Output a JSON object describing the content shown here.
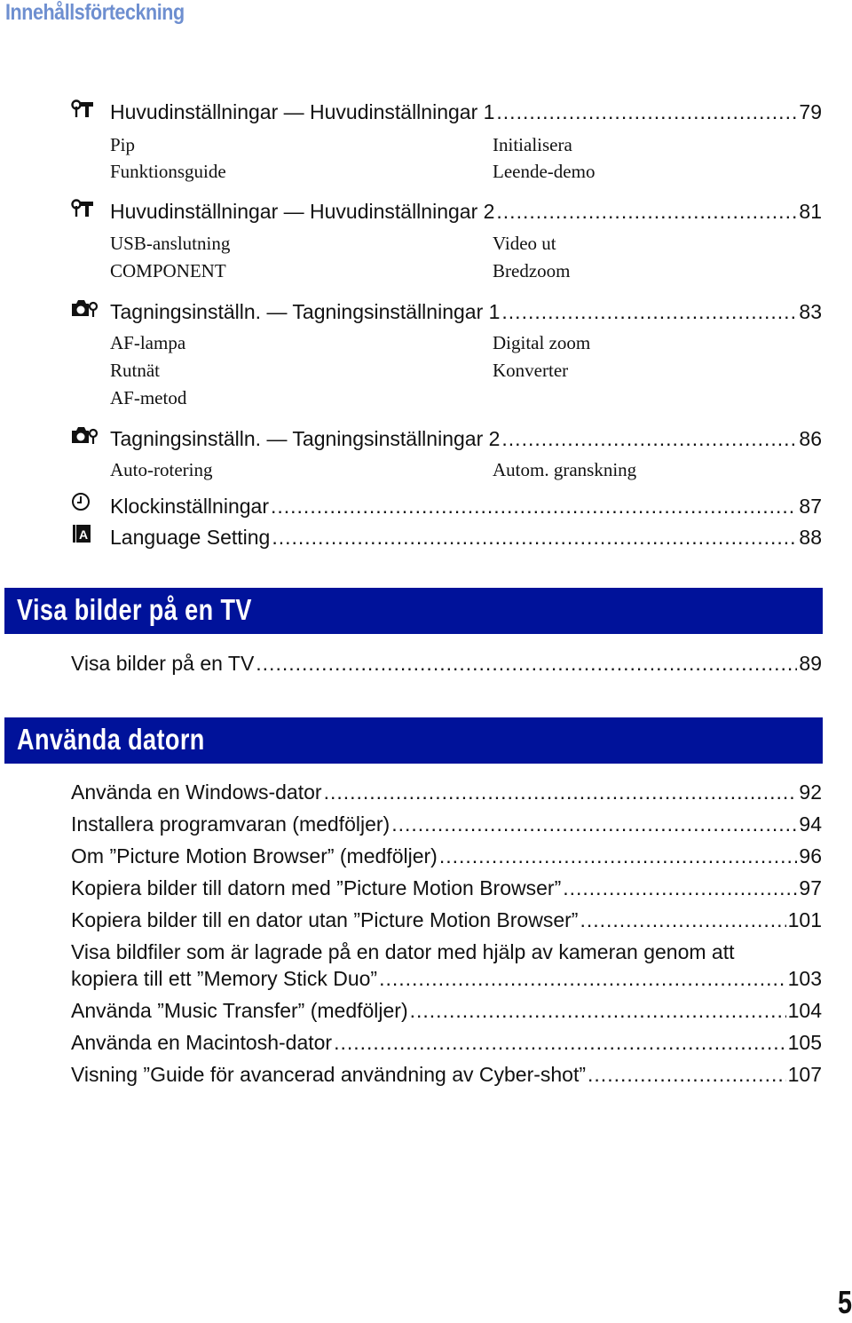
{
  "page_title": "Innehållsförteckning",
  "settings_entries": [
    {
      "icon": "wrench-hammer-icon",
      "label": "Huvudinställningar — Huvudinställningar 1",
      "page": "79",
      "sub_col1": [
        "Pip",
        "Funktionsguide"
      ],
      "sub_col2": [
        "Initialisera",
        "Leende-demo"
      ]
    },
    {
      "icon": "wrench-hammer-icon",
      "label": "Huvudinställningar — Huvudinställningar 2",
      "page": "81",
      "sub_col1": [
        "USB-anslutning",
        "COMPONENT"
      ],
      "sub_col2": [
        "Video ut",
        "Bredzoom"
      ]
    },
    {
      "icon": "camera-settings-icon",
      "label": "Tagningsinställn. — Tagningsinställningar 1",
      "page": "83",
      "sub_col1": [
        "AF-lampa",
        "Rutnät",
        "AF-metod"
      ],
      "sub_col2": [
        "Digital zoom",
        "Konverter"
      ]
    },
    {
      "icon": "camera-settings-icon",
      "label": "Tagningsinställn. — Tagningsinställningar 2",
      "page": "86",
      "sub_col1": [
        "Auto-rotering"
      ],
      "sub_col2": [
        "Autom. granskning"
      ]
    },
    {
      "icon": "clock-icon",
      "label": "Klockinställningar",
      "page": "87"
    },
    {
      "icon": "language-icon",
      "label": "Language Setting",
      "page": "88"
    }
  ],
  "sections": [
    {
      "title": "Visa bilder på en TV",
      "entries": [
        {
          "label": "Visa bilder på en TV",
          "page": "89"
        }
      ]
    },
    {
      "title": "Använda datorn",
      "entries": [
        {
          "label": "Använda en Windows-dator",
          "page": "92"
        },
        {
          "label": "Installera programvaran (medföljer)",
          "page": "94"
        },
        {
          "label": "Om ”Picture Motion Browser” (medföljer)",
          "page": "96"
        },
        {
          "label": "Kopiera bilder till datorn med ”Picture Motion Browser”",
          "page": "97"
        },
        {
          "label": "Kopiera bilder till en dator utan ”Picture Motion Browser”",
          "page": "101"
        },
        {
          "label_line1": "Visa bildfiler som är lagrade på en dator med hjälp av kameran genom att",
          "label": "kopiera till ett ”Memory Stick Duo”",
          "page": "103"
        },
        {
          "label": "Använda ”Music Transfer” (medföljer)",
          "page": "104"
        },
        {
          "label": "Använda en Macintosh-dator",
          "page": "105"
        },
        {
          "label": "Visning ”Guide för avancerad användning av Cyber-shot”",
          "page": "107"
        }
      ]
    }
  ],
  "page_number": "5",
  "colors": {
    "title": "#6e8fd0",
    "section_bar": "#00129a",
    "section_text": "#ffffff"
  }
}
